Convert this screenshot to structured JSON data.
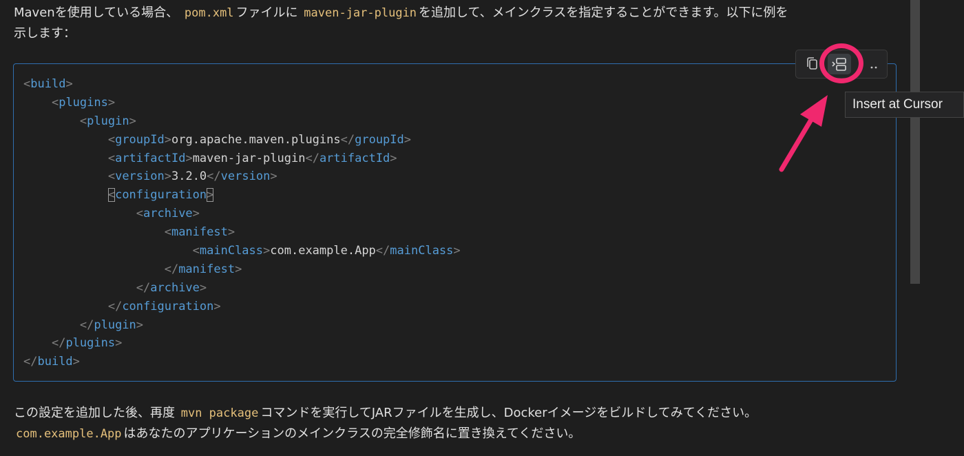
{
  "intro": {
    "line1_a": "Mavenを使用している場合、",
    "line1_code1": "pom.xml",
    "line1_b": "ファイルに",
    "line1_code2": "maven-jar-plugin",
    "line1_c": "を追加して、メインクラスを指定することができます。以下に例を",
    "line2": "示します："
  },
  "code_block": {
    "lines": [
      {
        "indent": "",
        "open": "build",
        "text": "",
        "close": ""
      },
      {
        "indent": "    ",
        "open": "plugins",
        "text": "",
        "close": ""
      },
      {
        "indent": "        ",
        "open": "plugin",
        "text": "",
        "close": ""
      },
      {
        "indent": "            ",
        "open": "groupId",
        "text": "org.apache.maven.plugins",
        "close": "groupId"
      },
      {
        "indent": "            ",
        "open": "artifactId",
        "text": "maven-jar-plugin",
        "close": "artifactId"
      },
      {
        "indent": "            ",
        "open": "version",
        "text": "3.2.0",
        "close": "version"
      },
      {
        "indent": "            ",
        "open": "configuration",
        "text": "",
        "close": "",
        "cursor": true
      },
      {
        "indent": "                ",
        "open": "archive",
        "text": "",
        "close": ""
      },
      {
        "indent": "                    ",
        "open": "manifest",
        "text": "",
        "close": ""
      },
      {
        "indent": "                        ",
        "open": "mainClass",
        "text": "com.example.App",
        "close": "mainClass"
      },
      {
        "indent": "                    ",
        "end": "manifest"
      },
      {
        "indent": "                ",
        "end": "archive"
      },
      {
        "indent": "            ",
        "end": "configuration"
      },
      {
        "indent": "        ",
        "end": "plugin"
      },
      {
        "indent": "    ",
        "end": "plugins"
      },
      {
        "indent": "",
        "end": "build"
      }
    ]
  },
  "toolbar": {
    "copy_icon": "copy-icon",
    "insert_icon": "insert-at-cursor-icon",
    "more_icon": "ellipsis-icon",
    "tooltip": "Insert at Cursor"
  },
  "outro": {
    "line1_a": "この設定を追加した後、再度",
    "line1_code": "mvn package",
    "line1_b": "コマンドを実行してJARファイルを生成し、Dockerイメージをビルドしてみてください。",
    "line2_code": "com.example.App",
    "line2_b": "はあなたのアプリケーションのメインクラスの完全修飾名に置き換えてください。"
  },
  "colors": {
    "highlight": "#f0286e",
    "tag": "#569cd6",
    "inline_code": "#e5c07b",
    "border": "#2f6fb0"
  }
}
